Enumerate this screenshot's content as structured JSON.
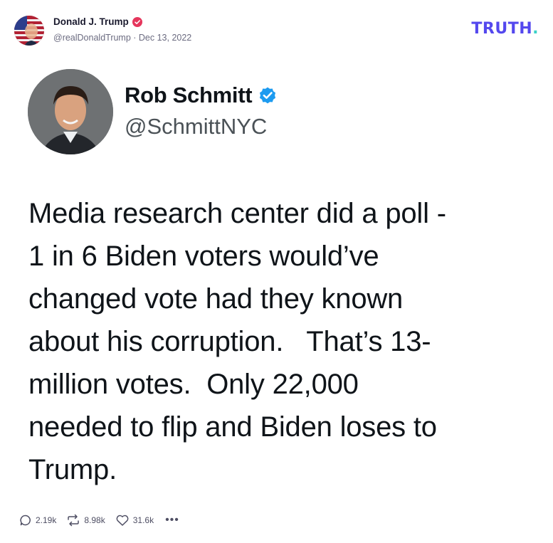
{
  "post": {
    "author_name": "Donald J. Trump",
    "meta": "@realDonaldTrump · Dec 13, 2022",
    "brand": "TRUTH",
    "brand_dot": ".",
    "colors": {
      "brand_purple": "#5448ee",
      "brand_teal": "#3ad1c8",
      "verified_red": "#e5365c",
      "twitter_blue": "#1d9bf0"
    }
  },
  "tweet": {
    "name": "Rob Schmitt",
    "handle": "@SchmittNYC",
    "text": "Media research center did a poll -\n1 in 6 Biden voters would’ve\nchanged vote had they known\nabout his corruption.   That’s 13-\nmillion votes.  Only 22,000\nneeded to flip and Biden loses to\nTrump."
  },
  "actions": {
    "replies": "2.19k",
    "retruths": "8.98k",
    "likes": "31.6k",
    "more": "•••"
  },
  "icons": {
    "reply": "reply-icon",
    "retruth": "retruth-icon",
    "like": "heart-icon",
    "more": "more-icon",
    "verified": "verified-badge-icon"
  }
}
